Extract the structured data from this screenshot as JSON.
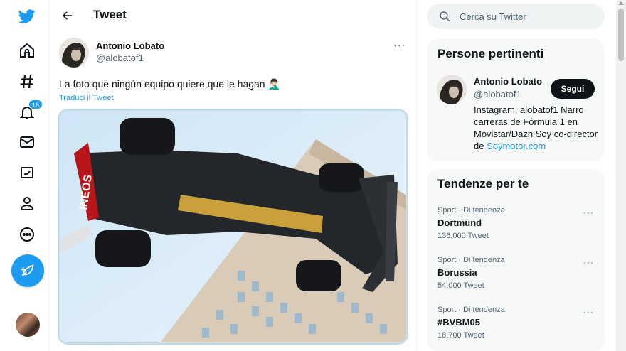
{
  "nav": {
    "notifications_badge": "16"
  },
  "header": {
    "title": "Tweet"
  },
  "tweet": {
    "author_name": "Antonio Lobato",
    "author_handle": "@alobatof1",
    "more": "···",
    "text": "La foto que ningún equipo quiere que le hagan 🤦🏻‍♂️",
    "translate_label": "Traduci il Tweet"
  },
  "search": {
    "placeholder": "Cerca su Twitter"
  },
  "people": {
    "title": "Persone pertinenti",
    "name": "Antonio Lobato",
    "handle": "@alobatof1",
    "follow_label": "Segui",
    "bio_text": "Instagram: alobatof1 Narro carreras de Fórmula 1 en Movistar/Dazn Soy co-director de ",
    "bio_link": "Soymotor.com"
  },
  "trends": {
    "title": "Tendenze per te",
    "items": [
      {
        "context": "Sport · Di tendenza",
        "name": "Dortmund",
        "count": "136.000 Tweet",
        "more": "···"
      },
      {
        "context": "Sport · Di tendenza",
        "name": "Borussia",
        "count": "54.000 Tweet",
        "more": "···"
      },
      {
        "context": "Sport · Di tendenza",
        "name": "#BVBM05",
        "count": "18.700 Tweet",
        "more": "···"
      }
    ]
  },
  "colors": {
    "accent": "#1d9bf0",
    "text": "#0f1419",
    "muted": "#536471"
  }
}
